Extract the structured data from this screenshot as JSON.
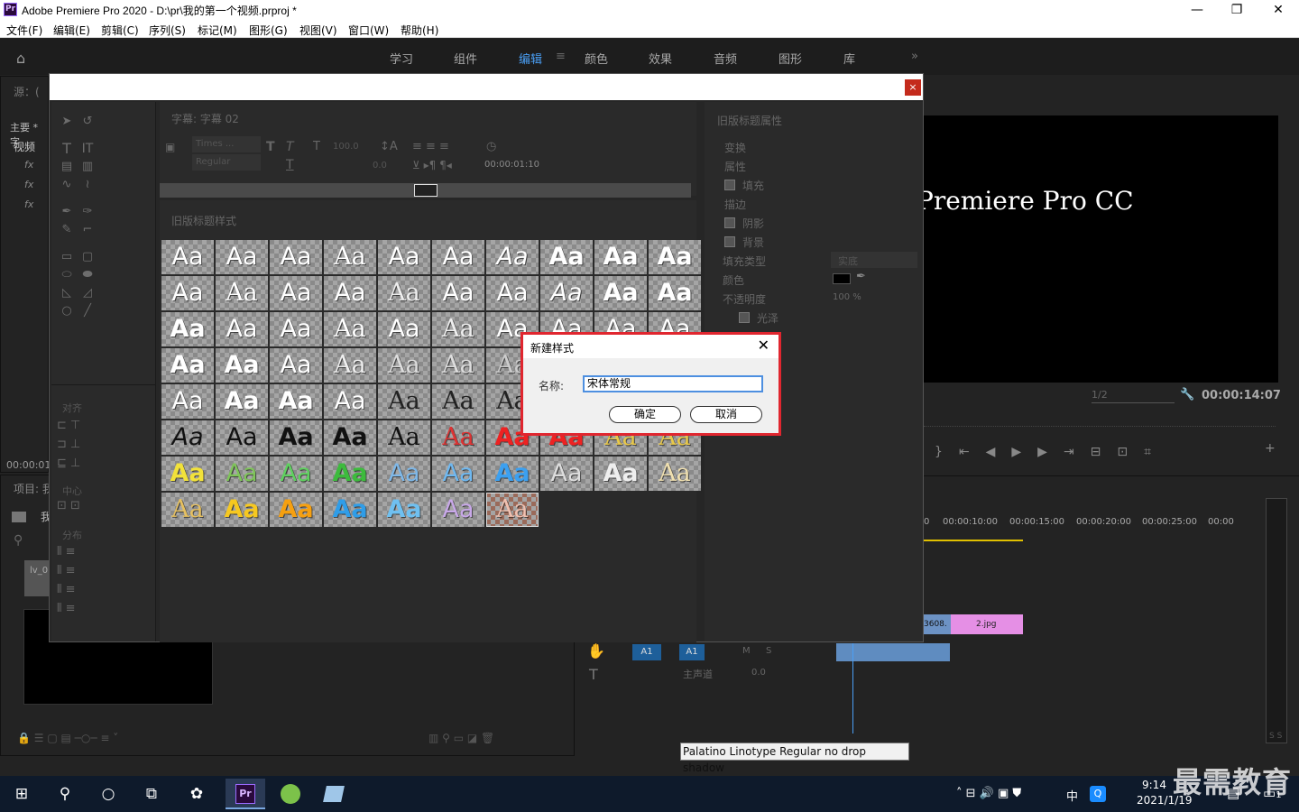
{
  "window": {
    "app_icon": "Pr",
    "title": "Adobe Premiere Pro 2020 - D:\\pr\\我的第一个视频.prproj *",
    "minimize": "—",
    "restore": "❐",
    "close": "✕"
  },
  "menu": [
    "文件(F)",
    "编辑(E)",
    "剪辑(C)",
    "序列(S)",
    "标记(M)",
    "图形(G)",
    "视图(V)",
    "窗口(W)",
    "帮助(H)"
  ],
  "workspaces": [
    {
      "label": "学习",
      "active": false
    },
    {
      "label": "组件",
      "active": false
    },
    {
      "label": "编辑",
      "active": true
    },
    {
      "label": "颜色",
      "active": false
    },
    {
      "label": "效果",
      "active": false
    },
    {
      "label": "音频",
      "active": false
    },
    {
      "label": "图形",
      "active": false
    },
    {
      "label": "库",
      "active": false
    }
  ],
  "left_panel": {
    "source_tab": "源：(",
    "main_tab": "主要 * 字",
    "video": "视频",
    "fx": "fx",
    "timecode": "00:00:01:",
    "project_tab": "项目: 我",
    "bin_label": "我",
    "thumb_label": "lv_0"
  },
  "titler": {
    "close": "×",
    "title_panel_header": "字幕: 字幕 02",
    "font_family": "Times ...",
    "font_style": "Regular",
    "font_size": "100.0",
    "kerning": "0.0",
    "timecode": "00:00:01:10",
    "styles_header": "旧版标题样式",
    "align_label": "对齐",
    "center_label": "中心",
    "distribute_label": "分布",
    "props_header": "旧版标题属性",
    "props": {
      "transform": "变换",
      "properties": "属性",
      "fill": "填充",
      "stroke": "描边",
      "shadow": "阴影",
      "background": "背景",
      "fill_type": "填充类型",
      "fill_type_value": "实底",
      "color": "颜色",
      "opacity": "不透明度",
      "opacity_value": "100 %",
      "sheen": "光泽"
    },
    "swatch_text": "Aa"
  },
  "dialog": {
    "title": "新建样式",
    "close": "✕",
    "name_label": "名称:",
    "name_value": "宋体常规",
    "ok": "确定",
    "cancel": "取消"
  },
  "program": {
    "preview_text": "Premiere Pro CC",
    "fit": "1/2",
    "timecode": "00:00:14:07"
  },
  "timeline": {
    "ruler": [
      "0",
      "00:00:10:00",
      "00:00:15:00",
      "00:00:20:00",
      "00:00:25:00",
      "00:00"
    ],
    "clip1": "3608.",
    "clip2": "2.jpg",
    "track_a1": "A1",
    "track_a1b": "A1",
    "track_m": "M",
    "track_s": "S",
    "master_label": "主声道",
    "master_value": "0.0",
    "meter_label": "S S"
  },
  "tooltip": "Palatino Linotype Regular no drop shadow",
  "taskbar": {
    "time": "9:14",
    "date": "2021/1/19",
    "ime": "中",
    "premiere": "Pr",
    "notification_count": "1"
  },
  "watermark": "最需教育"
}
